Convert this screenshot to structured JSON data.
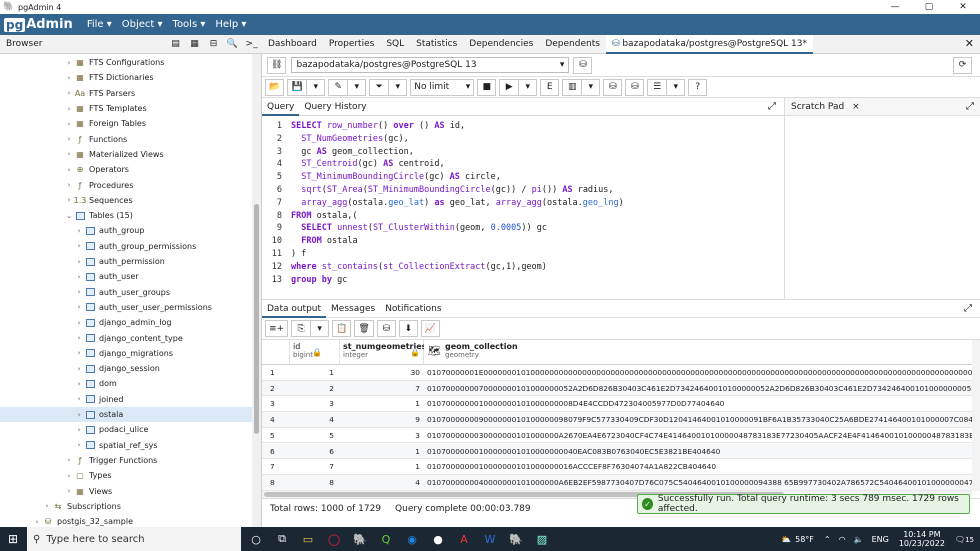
{
  "window": {
    "title": "pgAdmin 4",
    "min": "—",
    "max": "▢",
    "close": "✕"
  },
  "menubar": {
    "logo_pg": "pg",
    "logo_rest": "Admin",
    "items": [
      "File ▾",
      "Object ▾",
      "Tools ▾",
      "Help ▾"
    ]
  },
  "browser": {
    "label": "Browser"
  },
  "tree": [
    {
      "indent": 70,
      "chev": "›",
      "icon": "fts",
      "label": "FTS Configurations"
    },
    {
      "indent": 70,
      "chev": "›",
      "icon": "fts",
      "label": "FTS Dictionaries"
    },
    {
      "indent": 70,
      "chev": "›",
      "icon": "aa",
      "label": "FTS Parsers"
    },
    {
      "indent": 70,
      "chev": "›",
      "icon": "fts",
      "label": "FTS Templates"
    },
    {
      "indent": 70,
      "chev": "›",
      "icon": "ft",
      "label": "Foreign Tables"
    },
    {
      "indent": 70,
      "chev": "›",
      "icon": "fn",
      "label": "Functions"
    },
    {
      "indent": 70,
      "chev": "›",
      "icon": "mv",
      "label": "Materialized Views"
    },
    {
      "indent": 70,
      "chev": "›",
      "icon": "op",
      "label": "Operators"
    },
    {
      "indent": 70,
      "chev": "›",
      "icon": "pr",
      "label": "Procedures"
    },
    {
      "indent": 70,
      "chev": "›",
      "icon": "sq",
      "label": "Sequences"
    },
    {
      "indent": 70,
      "chev": "⌄",
      "icon": "tbl",
      "label": "Tables (15)"
    },
    {
      "indent": 80,
      "chev": "›",
      "icon": "tbl",
      "label": "auth_group"
    },
    {
      "indent": 80,
      "chev": "›",
      "icon": "tbl",
      "label": "auth_group_permissions"
    },
    {
      "indent": 80,
      "chev": "›",
      "icon": "tbl",
      "label": "auth_permission"
    },
    {
      "indent": 80,
      "chev": "›",
      "icon": "tbl",
      "label": "auth_user"
    },
    {
      "indent": 80,
      "chev": "›",
      "icon": "tbl",
      "label": "auth_user_groups"
    },
    {
      "indent": 80,
      "chev": "›",
      "icon": "tbl",
      "label": "auth_user_user_permissions"
    },
    {
      "indent": 80,
      "chev": "›",
      "icon": "tbl",
      "label": "django_admin_log"
    },
    {
      "indent": 80,
      "chev": "›",
      "icon": "tbl",
      "label": "django_content_type"
    },
    {
      "indent": 80,
      "chev": "›",
      "icon": "tbl",
      "label": "django_migrations"
    },
    {
      "indent": 80,
      "chev": "›",
      "icon": "tbl",
      "label": "django_session"
    },
    {
      "indent": 80,
      "chev": "›",
      "icon": "tbl",
      "label": "dom"
    },
    {
      "indent": 80,
      "chev": "›",
      "icon": "tbl",
      "label": "joined"
    },
    {
      "indent": 80,
      "chev": "›",
      "icon": "tbl",
      "label": "ostala",
      "selected": true
    },
    {
      "indent": 80,
      "chev": "›",
      "icon": "tbl",
      "label": "podaci_ulice"
    },
    {
      "indent": 80,
      "chev": "›",
      "icon": "tbl",
      "label": "spatial_ref_sys"
    },
    {
      "indent": 70,
      "chev": "›",
      "icon": "tr",
      "label": "Trigger Functions"
    },
    {
      "indent": 70,
      "chev": "›",
      "icon": "ty",
      "label": "Types"
    },
    {
      "indent": 70,
      "chev": "›",
      "icon": "vw",
      "label": "Views"
    },
    {
      "indent": 48,
      "chev": "›",
      "icon": "sub",
      "label": "Subscriptions"
    },
    {
      "indent": 38,
      "chev": "›",
      "icon": "db",
      "label": "postgis_32_sample"
    }
  ],
  "tabs": [
    "Dashboard",
    "Properties",
    "SQL",
    "Statistics",
    "Dependencies",
    "Dependents"
  ],
  "active_tab": "bazapodataka/postgres@PostgreSQL 13*",
  "connection": {
    "label": "bazapodataka/postgres@PostgreSQL 13",
    "caret": "▾"
  },
  "toolbar": {
    "limit": "No limit"
  },
  "query_tabs": {
    "query": "Query",
    "history": "Query History"
  },
  "scratch": {
    "label": "Scratch Pad",
    "close": "×"
  },
  "editor": {
    "lines": [
      "SELECT row_number() over () AS id,",
      "  ST_NumGeometries(gc),",
      "  gc AS geom_collection,",
      "  ST_Centroid(gc) AS centroid,",
      "  ST_MinimumBoundingCircle(gc) AS circle,",
      "  sqrt(ST_Area(ST_MinimumBoundingCircle(gc)) / pi()) AS radius,",
      "  array_agg(ostala.geo_lat) as geo_lat, array_agg(ostala.geo_lng)",
      "FROM ostala,(",
      "  SELECT unnest(ST_ClusterWithin(geom, 0.0005)) gc",
      "  FROM ostala",
      ") f",
      "where st_contains(st_CollectionExtract(gc,1),geom)",
      "group by gc"
    ]
  },
  "result_tabs": [
    "Data output",
    "Messages",
    "Notifications"
  ],
  "grid": {
    "columns": [
      {
        "name": "id",
        "type": "bigint"
      },
      {
        "name": "st_numgeometries",
        "type": "integer"
      },
      {
        "name": "geom_collection",
        "type": "geometry"
      }
    ],
    "rows": [
      {
        "n": "1",
        "id": "1",
        "num": "30",
        "geom": "01070000001E000000010100000000000000000000000000000000000000000000000000000000000000000000000000000000000000000000000000000000000000000"
      },
      {
        "n": "2",
        "id": "2",
        "num": "7",
        "geom": "0107000000070000000101000000052A2D6D826B30403C461E2D73424640010100000052A2D6D826B30403C461E2D7342464001010000000052A2D6D8"
      },
      {
        "n": "3",
        "id": "3",
        "num": "1",
        "geom": "0107000000010000000101000000008D4E4CCDD472304005977D0D77404640"
      },
      {
        "n": "4",
        "id": "4",
        "num": "9",
        "geom": "010700000009000000010100000098079F9C577330409CDF30D12041464001010000091BF6A1B35733040C25A6BDE274146400101000007C084F8D3"
      },
      {
        "n": "5",
        "id": "5",
        "num": "3",
        "geom": "0107000000030000000101000000A2670EA4E6723040CF4C74E41464001010000048783183E77230405AACF24E4F41464001010000048783183E7"
      },
      {
        "n": "6",
        "id": "6",
        "num": "1",
        "geom": "01070000000100000001010000000040EAC083B0763040EC5E3821BE404640"
      },
      {
        "n": "7",
        "id": "7",
        "num": "1",
        "geom": "0107000000010000000101000000016ACCCEF8F76304074A1A822CB404640"
      },
      {
        "n": "8",
        "id": "8",
        "num": "4",
        "geom": "0107000000040000000101000000A6EB2EF5987730407D76C075C5404640010100000094388 65B997730402A786572C5404640010100000004787D1BD98"
      }
    ]
  },
  "status": {
    "rows": "Total rows: 1000 of 1729",
    "complete": "Query complete 00:00:03.789"
  },
  "toast": {
    "check": "✓",
    "text": "Successfully run. Total query runtime: 3 secs 789 msec. 1729 rows affected.",
    "close": "✕"
  },
  "taskbar": {
    "search": "Type here to search",
    "weather": "58°F",
    "lang": "ENG",
    "time": "10:14 PM",
    "date": "10/23/2022",
    "notif": "15"
  }
}
